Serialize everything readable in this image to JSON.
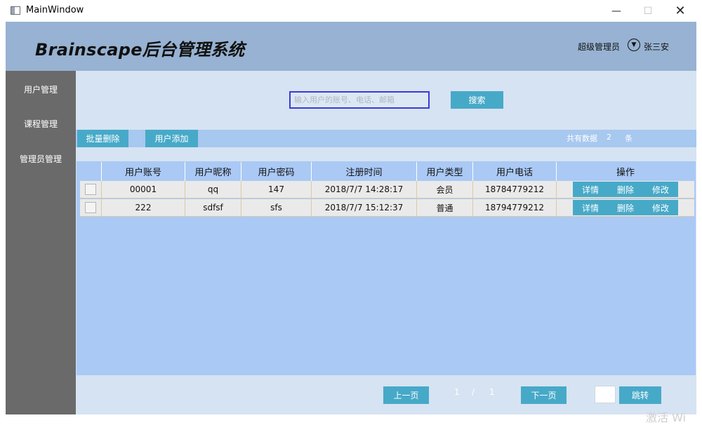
{
  "window": {
    "title": "MainWindow",
    "minimize": "—",
    "maximize": "☐",
    "close": "✕"
  },
  "header": {
    "brand": "Brainscape后台管理系统",
    "role": "超级管理员",
    "user": "张三安"
  },
  "sidebar": {
    "items": [
      {
        "label": "用户管理"
      },
      {
        "label": "课程管理"
      },
      {
        "label": "管理员管理"
      }
    ]
  },
  "search": {
    "placeholder": "输入用户的账号、电话、邮箱",
    "button": "搜索"
  },
  "toolbar": {
    "batch_delete": "批量删除",
    "add_user": "用户添加",
    "count_label": "共有数据",
    "count_value": "2",
    "count_unit": "条"
  },
  "table": {
    "columns": [
      "",
      "用户账号",
      "用户昵称",
      "用户密码",
      "注册时间",
      "用户类型",
      "用户电话",
      "操作"
    ],
    "rows": [
      {
        "account": "00001",
        "nickname": "qq",
        "password": "147",
        "registered": "2018/7/7 14:28:17",
        "type": "会员",
        "phone": "18784779212"
      },
      {
        "account": "222",
        "nickname": "sdfsf",
        "password": "sfs",
        "registered": "2018/7/7 15:12:37",
        "type": "普通",
        "phone": "18794779212"
      }
    ],
    "actions": {
      "detail": "详情",
      "delete": "删除",
      "edit": "修改"
    }
  },
  "pager": {
    "prev": "上一页",
    "current": "1",
    "sep": "/",
    "total": "1",
    "next": "下一页",
    "jump": "跳转",
    "jump_value": ""
  },
  "watermark": "激活 Wi",
  "colors": {
    "header": "#97b2d2",
    "sidebar": "#6a6a6a",
    "content": "#d6e3f2",
    "table_bg": "#aac9f5",
    "accent_button": "#47a9c8"
  }
}
